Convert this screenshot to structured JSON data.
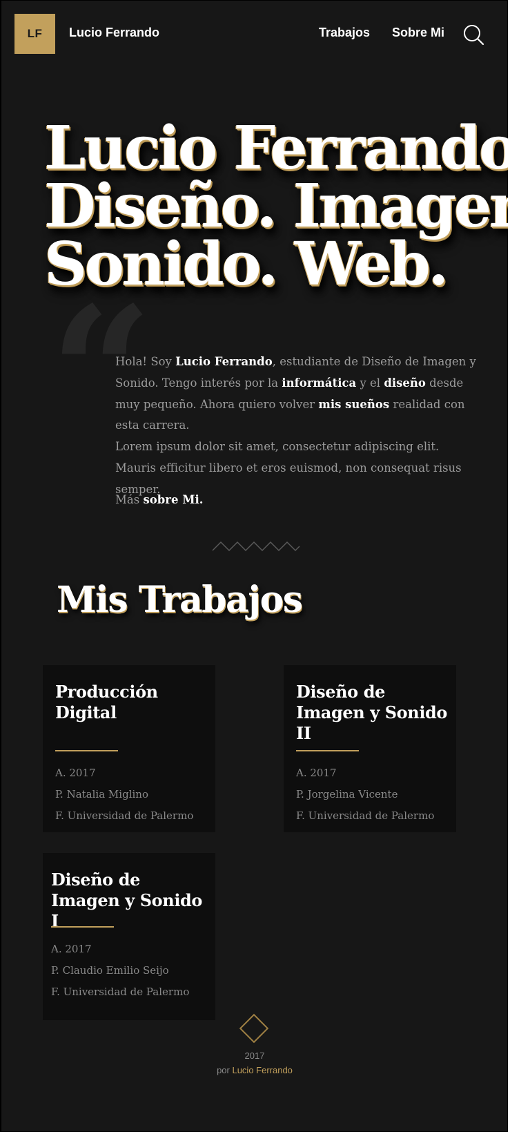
{
  "header": {
    "logo_text": "LF",
    "site_name": "Lucio Ferrando",
    "nav": [
      "Trabajos",
      "Sobre Mi"
    ],
    "search_icon": "search-icon"
  },
  "hero": {
    "lines": [
      "Lucio Ferrando.",
      "Diseño. Imagen.",
      "Sonido. Web."
    ]
  },
  "intro": {
    "quote_glyph": "“",
    "p1_a": "Hola! Soy ",
    "p1_name": "Lucio Ferrando",
    "p1_b": ", estudiante de Diseño de Imagen y Sonido. Tengo interés por la ",
    "p1_informatica": "informática",
    "p1_c": " y el ",
    "p1_diseno": "diseño",
    "p1_d": " desde muy pequeño. Ahora quiero volver ",
    "p1_suenos": "mis sueños",
    "p1_e": " realidad con esta carrera.",
    "p2": "Lorem ipsum dolor sit amet, consectetur adipiscing elit. Mauris efficitur libero et eros euismod, non consequat risus semper.",
    "more_prefix": "Más ",
    "more_link": "sobre Mi."
  },
  "works": {
    "title": "Mis Trabajos",
    "cards": [
      {
        "title": "Producción Digital",
        "year": "A. 2017",
        "professor": "P. Natalia Miglino",
        "faculty": "F. Universidad de Palermo"
      },
      {
        "title": "Diseño de Imagen y Sonido II",
        "year": "A. 2017",
        "professor": "P. Jorgelina Vicente",
        "faculty": "F. Universidad de Palermo"
      },
      {
        "title": "Diseño de Imagen y Sonido I",
        "year": "A. 2017",
        "professor": "P. Claudio Emilio Seijo",
        "faculty": "F. Universidad de Palermo"
      }
    ]
  },
  "footer": {
    "year": "2017",
    "by_prefix": "por ",
    "author": "Lucio Ferrando"
  },
  "colors": {
    "background": "#171717",
    "accent_gold": "#c2a05c",
    "card_bg": "#0e0e0e",
    "text_muted": "#9c9c9c",
    "text_strong": "#ffffff"
  }
}
